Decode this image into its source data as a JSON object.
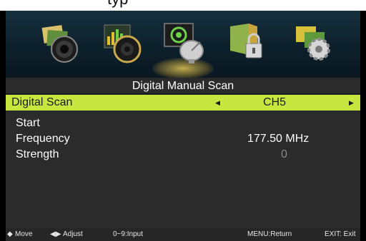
{
  "topbar": {
    "fragment": "typ"
  },
  "menu_icons": [
    {
      "name": "picture-icon"
    },
    {
      "name": "sound-icon"
    },
    {
      "name": "channel-icon"
    },
    {
      "name": "lock-icon"
    },
    {
      "name": "setup-icon"
    }
  ],
  "panel": {
    "title": "Digital Manual Scan",
    "selected_row": {
      "label": "Digital Scan",
      "value": "CH5"
    },
    "start_label": "Start",
    "frequency": {
      "label": "Frequency",
      "value": "177.50  MHz"
    },
    "strength": {
      "label": "Strength",
      "value": "0"
    }
  },
  "footer": {
    "move": "Move",
    "adjust": "Adjust",
    "input": "0~9:Input",
    "menu": "MENU:Return",
    "exit": "EXIT: Exit"
  },
  "colors": {
    "highlight": "#c9e640",
    "panel_bg": "#2b2b2b",
    "iconbar_bg": "#0c1f2a"
  }
}
